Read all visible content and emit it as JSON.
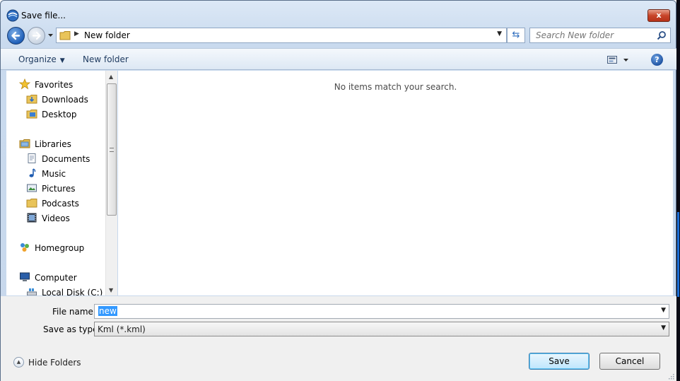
{
  "window": {
    "title": "Save file..."
  },
  "titlebar": {
    "close_label": "x"
  },
  "navigation": {
    "address_path": "New folder",
    "search_placeholder": "Search New folder"
  },
  "toolbar": {
    "organize_label": "Organize",
    "new_folder_label": "New folder",
    "help_label": "?"
  },
  "sidebar": {
    "items": [
      {
        "label": "Favorites",
        "icon": "star-icon"
      },
      {
        "label": "Downloads",
        "icon": "downloads-folder-icon"
      },
      {
        "label": "Desktop",
        "icon": "desktop-folder-icon"
      },
      {
        "label": "Libraries",
        "icon": "libraries-icon"
      },
      {
        "label": "Documents",
        "icon": "documents-icon"
      },
      {
        "label": "Music",
        "icon": "music-icon"
      },
      {
        "label": "Pictures",
        "icon": "pictures-icon"
      },
      {
        "label": "Podcasts",
        "icon": "podcasts-folder-icon"
      },
      {
        "label": "Videos",
        "icon": "videos-icon"
      },
      {
        "label": "Homegroup",
        "icon": "homegroup-icon"
      },
      {
        "label": "Computer",
        "icon": "computer-icon"
      },
      {
        "label": "Local Disk (C:)",
        "icon": "local-disk-icon"
      }
    ]
  },
  "content": {
    "empty_message": "No items match your search."
  },
  "form": {
    "file_name_label": "File name:",
    "file_name_value": "new",
    "save_as_type_label": "Save as type:",
    "save_as_type_value": "Kml (*.kml)"
  },
  "footer": {
    "hide_folders_label": "Hide Folders",
    "save_label": "Save",
    "cancel_label": "Cancel"
  },
  "colors": {
    "accent": "#3399ff",
    "chrome": "#c9daee",
    "close_red": "#c8452a"
  }
}
